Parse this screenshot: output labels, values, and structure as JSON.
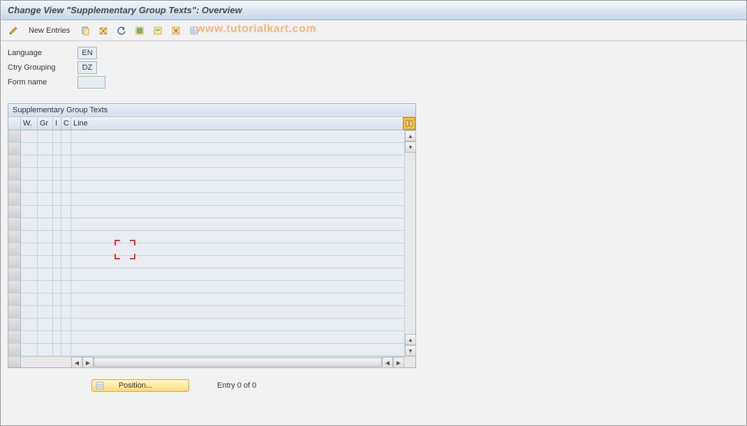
{
  "header": {
    "title": "Change View \"Supplementary Group Texts\": Overview"
  },
  "toolbar": {
    "new_entries_label": "New Entries"
  },
  "watermark": "www.tutorialkart.com",
  "form": {
    "language_label": "Language",
    "language_value": "EN",
    "ctry_grouping_label": "Ctry Grouping",
    "ctry_grouping_value": "DZ",
    "form_name_label": "Form name",
    "form_name_value": ""
  },
  "table": {
    "panel_title": "Supplementary Group Texts",
    "columns": {
      "w": "W.",
      "gr": "Gr",
      "i": "I",
      "c": "C",
      "line": "Line"
    },
    "rows": []
  },
  "footer": {
    "position_label": "Position...",
    "entry_text": "Entry 0 of 0"
  }
}
